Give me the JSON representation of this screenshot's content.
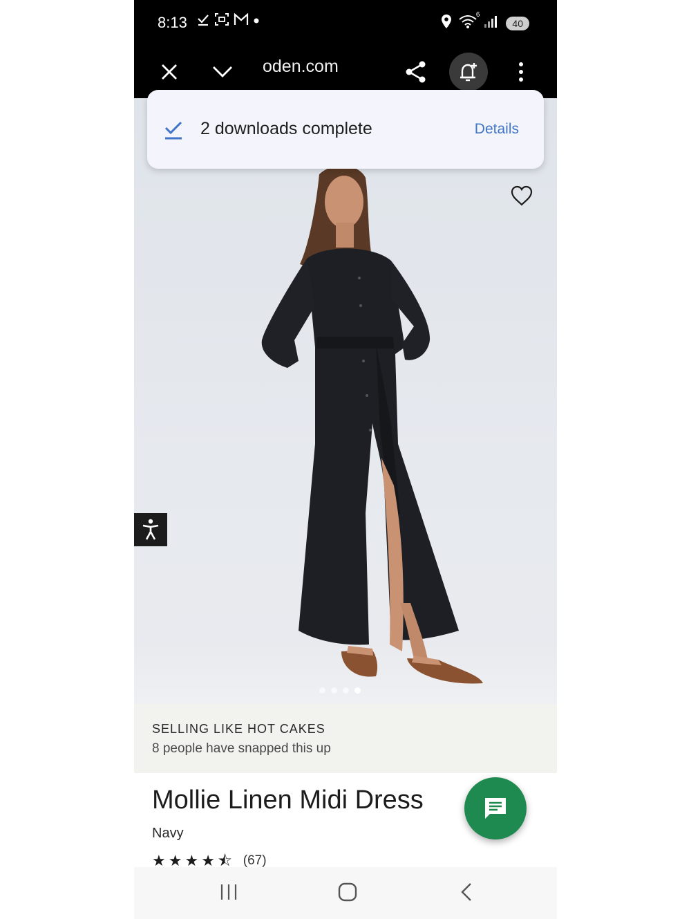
{
  "status_bar": {
    "time": "8:13",
    "left_icons": [
      "download-done-icon",
      "screenshot-icon",
      "gmail-icon",
      "dot-icon"
    ],
    "right_icons": [
      "location-icon",
      "wifi-icon",
      "signal-icon"
    ],
    "wifi_label": "6",
    "battery": "40"
  },
  "toolbar": {
    "url": "oden.com",
    "buttons": [
      "close-icon",
      "chevron-down-icon",
      "share-icon",
      "add-alert-icon",
      "more-vert-icon"
    ]
  },
  "snackbar": {
    "message": "2 downloads complete",
    "action": "Details"
  },
  "hero": {
    "image_alt": "model-wearing-navy-linen-midi-dress",
    "carousel_count": 4,
    "carousel_active": 4
  },
  "promo": {
    "title": "SELLING LIKE HOT CAKES",
    "subtitle": "8 people have snapped this up"
  },
  "product": {
    "name": "Mollie Linen Midi Dress",
    "color": "Navy",
    "rating": 4.5,
    "review_count": "(67)"
  },
  "colors": {
    "chat_fab": "#1e8a4f",
    "snackbar_action": "#3f74c7",
    "snackbar_bg": "#f4f5fc"
  },
  "nav_bar": {
    "buttons": [
      "recents-icon",
      "home-icon",
      "back-icon"
    ]
  }
}
